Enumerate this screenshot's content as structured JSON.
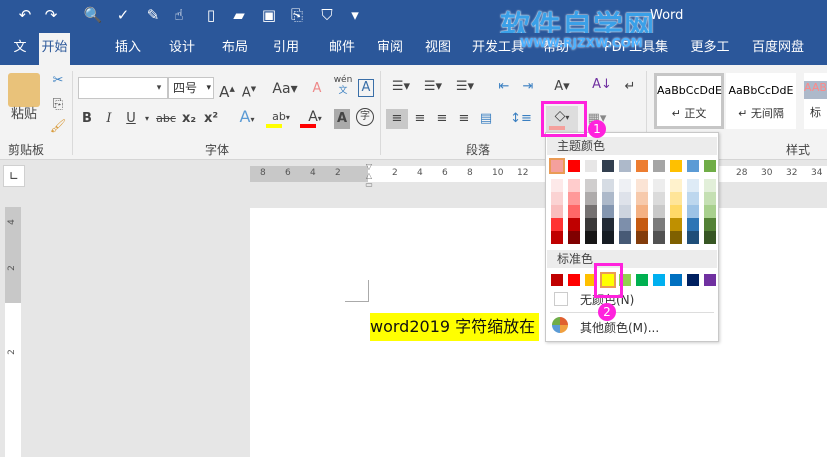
{
  "window": {
    "title": "Word",
    "watermark": "软件自学网",
    "watermark_url": "WWW.RJZXW.COM"
  },
  "quick_access": [
    {
      "icon": "undo-icon",
      "g": "↶"
    },
    {
      "icon": "redo-icon",
      "g": "↷"
    },
    {
      "icon": "print-preview-icon",
      "g": "🔍"
    },
    {
      "icon": "spelling-icon",
      "g": "✓"
    },
    {
      "icon": "edit-icon",
      "g": "✎"
    },
    {
      "icon": "touch-mode-icon",
      "g": "☝"
    },
    {
      "icon": "new-document-icon",
      "g": "▯"
    },
    {
      "icon": "open-folder-icon",
      "g": "▰"
    },
    {
      "icon": "save-icon",
      "g": "▣"
    },
    {
      "icon": "attach-icon",
      "g": "⎘"
    },
    {
      "icon": "security-icon",
      "g": "⛉"
    },
    {
      "icon": "customize-icon",
      "g": "▾"
    }
  ],
  "tabs": [
    "文件",
    "开始",
    "插入",
    "设计",
    "布局",
    "引用",
    "邮件",
    "审阅",
    "视图",
    "开发工具",
    "帮助",
    "PDF工具集",
    "更多工具",
    "百度网盘"
  ],
  "active_tab": "开始",
  "ribbon": {
    "clipboard": {
      "label": "剪贴板",
      "paste": "粘贴"
    },
    "font": {
      "label": "字体",
      "font_name": "",
      "font_size": "四号",
      "phonetic": "wén",
      "phonetic_char": "文",
      "bold": "B",
      "italic": "I",
      "underline": "U",
      "strike": "abc",
      "sub": "x₂",
      "sup": "x²",
      "enclose": "字"
    },
    "paragraph": {
      "label": "段落"
    },
    "styles": {
      "label": "样式",
      "items": [
        {
          "preview": "AaBbCcDdE",
          "name": "↵ 正文"
        },
        {
          "preview": "AaBbCcDdE",
          "name": "↵ 无间隔"
        },
        {
          "preview": "AAB",
          "name": "标"
        }
      ]
    }
  },
  "ruler": {
    "left_numbers": [
      "8",
      "6",
      "4",
      "2"
    ],
    "right_numbers": [
      "2",
      "4",
      "6",
      "8",
      "10",
      "12"
    ],
    "far_numbers": [
      "28",
      "30",
      "32",
      "34"
    ],
    "vertical_numbers": [
      "4",
      "2",
      "2"
    ]
  },
  "document": {
    "text": "word2019 字符缩放在"
  },
  "shading_menu": {
    "theme_header": "主题颜色",
    "theme_colors": [
      "#f4a09c",
      "#ff0000",
      "#e7e6e6",
      "#323f4f",
      "#adb9ca",
      "#ed7d31",
      "#a5a5a5",
      "#ffc000",
      "#5b9bd5",
      "#70ad47"
    ],
    "theme_shades": [
      [
        "#fde9e9",
        "#fbd3d3",
        "#f9bdbd",
        "#ff3333",
        "#c00000"
      ],
      [
        "#ffcccc",
        "#ff9999",
        "#ff6666",
        "#bf0000",
        "#800000"
      ],
      [
        "#d0cece",
        "#aeabab",
        "#757171",
        "#3a3838",
        "#171616"
      ],
      [
        "#d6dce4",
        "#adb9ca",
        "#8496b0",
        "#222a35",
        "#161c23"
      ],
      [
        "#eef0f4",
        "#dee2ea",
        "#cdd4df",
        "#7d8fab",
        "#475a76"
      ],
      [
        "#fbe4d5",
        "#f7caac",
        "#f4b183",
        "#c55a11",
        "#833c0b"
      ],
      [
        "#ededed",
        "#dbdbdb",
        "#c9c9c9",
        "#7b7b7b",
        "#525252"
      ],
      [
        "#fff2cc",
        "#ffe599",
        "#ffd966",
        "#bf9000",
        "#7f6000"
      ],
      [
        "#deebf6",
        "#bdd7ee",
        "#9dc3e6",
        "#2e75b5",
        "#1f4e79"
      ],
      [
        "#e2efd9",
        "#c5e0b3",
        "#a8d08d",
        "#538135",
        "#375623"
      ]
    ],
    "standard_header": "标准色",
    "standard_colors": [
      "#c00000",
      "#ff0000",
      "#ffc000",
      "#ffff00",
      "#92d050",
      "#00b050",
      "#00b0f0",
      "#0070c0",
      "#002060",
      "#7030a0"
    ],
    "selected_standard": "#ffff00",
    "no_color": "无颜色(N)",
    "more_colors": "其他颜色(M)..."
  },
  "callouts": [
    "1",
    "2"
  ],
  "accent": "#2b579a",
  "highlight_color": "#ffff00",
  "font_color": "#ff0000"
}
